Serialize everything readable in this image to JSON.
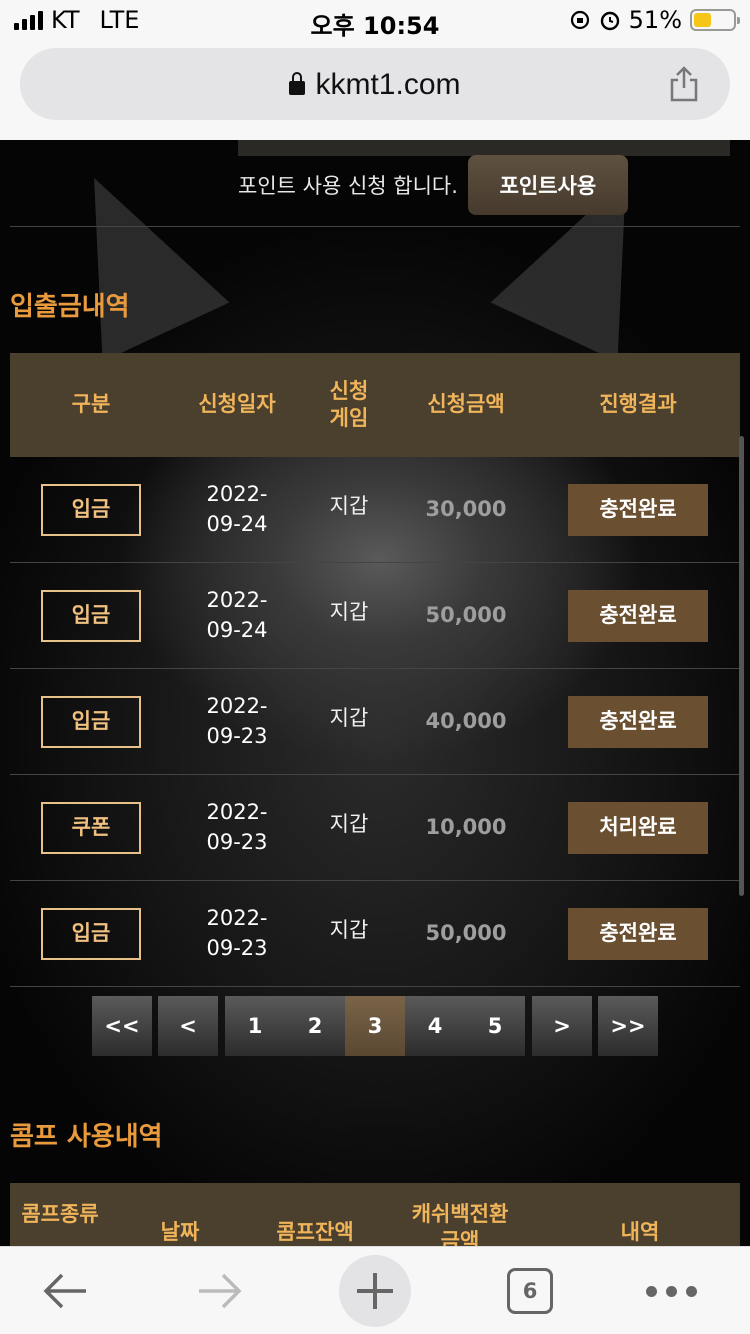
{
  "status_bar": {
    "carrier": "KT",
    "network": "LTE",
    "time": "오후 10:54",
    "battery": "51%",
    "battery_level": 0.51
  },
  "browser": {
    "url": "kkmt1.com",
    "tab_count": "6"
  },
  "point": {
    "text": "포인트 사용 신청 합니다.",
    "button": "포인트사용"
  },
  "deposit_history": {
    "title": "입출금내역",
    "headers": {
      "type": "구분",
      "date": "신청일자",
      "game": "신청\n게임",
      "amount": "신청금액",
      "result": "진행결과"
    },
    "rows": [
      {
        "type": "입금",
        "date": "2022-\n09-24",
        "game": "지갑",
        "amount": "30,000",
        "result": "충전완료"
      },
      {
        "type": "입금",
        "date": "2022-\n09-24",
        "game": "지갑",
        "amount": "50,000",
        "result": "충전완료"
      },
      {
        "type": "입금",
        "date": "2022-\n09-23",
        "game": "지갑",
        "amount": "40,000",
        "result": "충전완료"
      },
      {
        "type": "쿠폰",
        "date": "2022-\n09-23",
        "game": "지갑",
        "amount": "10,000",
        "result": "처리완료"
      },
      {
        "type": "입금",
        "date": "2022-\n09-23",
        "game": "지갑",
        "amount": "50,000",
        "result": "충전완료"
      }
    ]
  },
  "pagination": {
    "first": "<<",
    "prev": "<",
    "pages": [
      "1",
      "2",
      "3",
      "4",
      "5"
    ],
    "current": "3",
    "next": ">",
    "last": ">>"
  },
  "comp_history": {
    "title": "콤프 사용내역",
    "headers": {
      "type": "콤프종류",
      "date": "날짜",
      "balance": "콤프잔액",
      "cashback": "캐쉬백전환금액",
      "detail": "내역"
    }
  },
  "colors": {
    "accent": "#e89a3c",
    "header_bg": "#4b3f2d",
    "button_brown": "#6a4f30"
  }
}
